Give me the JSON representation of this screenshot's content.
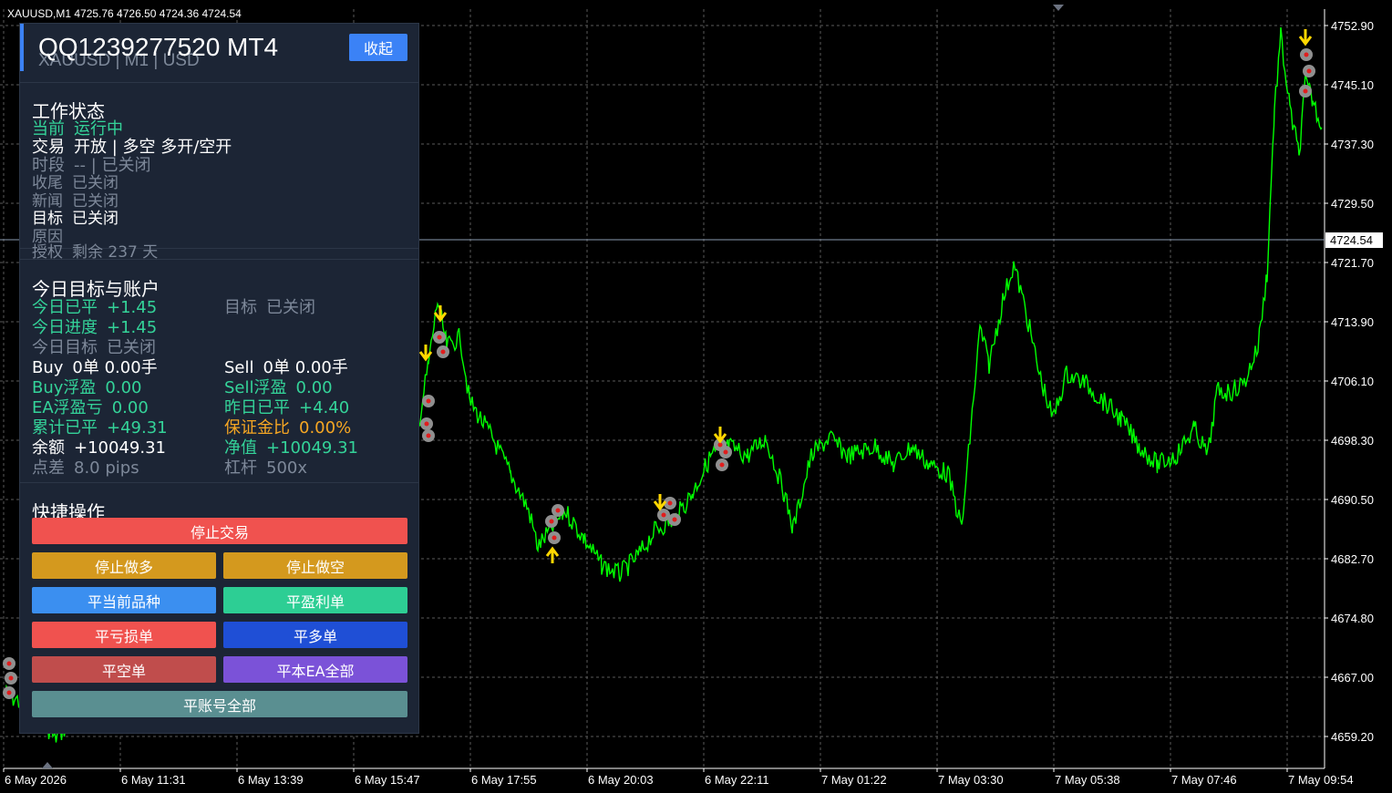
{
  "chart": {
    "symbol_line": "XAUUSD,M1  4725.76 4726.50 4724.36 4724.54",
    "current_price": "4724.54",
    "price_ticks": [
      "4752.90",
      "4745.10",
      "4737.30",
      "4729.50",
      "4721.70",
      "4713.90",
      "4706.10",
      "4698.30",
      "4690.50",
      "4682.70",
      "4674.80",
      "4667.00",
      "4659.20"
    ],
    "time_ticks": [
      "6 May 2026",
      "6 May 11:31",
      "6 May 13:39",
      "6 May 15:47",
      "6 May 17:55",
      "6 May 20:03",
      "6 May 22:11",
      "7 May 01:22",
      "7 May 03:30",
      "7 May 05:38",
      "7 May 07:46",
      "7 May 09:54"
    ],
    "colors": {
      "price_line": "#00ff00",
      "grid": "#5a5a5a",
      "arrow": "#ffd700"
    }
  },
  "panel": {
    "title": "QQ1239277520 MT4",
    "subtitle": "XAUUSD | M1 | USD",
    "collapse_label": "收起",
    "status": {
      "heading": "工作状态",
      "current_label": "当前",
      "current_value": "运行中",
      "trade_label": "交易",
      "trade_value": "开放 | 多空  多开/空开",
      "session_label": "时段",
      "session_value": "--  | 已关闭",
      "close_label": "收尾",
      "close_value": "已关闭",
      "news_label": "新闻",
      "news_value": "已关闭",
      "target_label": "目标",
      "target_value": "已关闭",
      "reason_label": "原因",
      "license_label": "授权",
      "license_value": "剩余 237 天"
    },
    "account": {
      "heading": "今日目标与账户",
      "today_closed_label": "今日已平",
      "today_closed_value": "+1.45",
      "target2_label": "目标",
      "target2_value": "已关闭",
      "progress_label": "今日进度",
      "progress_value": "+1.45",
      "today_target_label": "今日目标",
      "today_target_value": "已关闭",
      "buy_label": "Buy",
      "buy_value": "0单  0.00手",
      "sell_label": "Sell",
      "sell_value": "0单  0.00手",
      "buy_float_label": "Buy浮盈",
      "buy_float_value": "0.00",
      "sell_float_label": "Sell浮盈",
      "sell_float_value": "0.00",
      "ea_float_label": "EA浮盈亏",
      "ea_float_value": "0.00",
      "yesterday_label": "昨日已平",
      "yesterday_value": "+4.40",
      "cum_label": "累计已平",
      "cum_value": "+49.31",
      "margin_label": "保证金比",
      "margin_value": "0.00%",
      "balance_label": "余额",
      "balance_value": "+10049.31",
      "equity_label": "净值",
      "equity_value": "+10049.31",
      "spread_label": "点差",
      "spread_value": "8.0 pips",
      "leverage_label": "杠杆",
      "leverage_value": "500x"
    },
    "actions": {
      "heading": "快捷操作",
      "stop_trading": "停止交易",
      "stop_long": "停止做多",
      "stop_short": "停止做空",
      "close_symbol": "平当前品种",
      "close_profit": "平盈利单",
      "close_loss": "平亏损单",
      "close_buy": "平多单",
      "close_sell": "平空单",
      "close_ea_all": "平本EA全部",
      "close_account_all": "平账号全部"
    }
  }
}
